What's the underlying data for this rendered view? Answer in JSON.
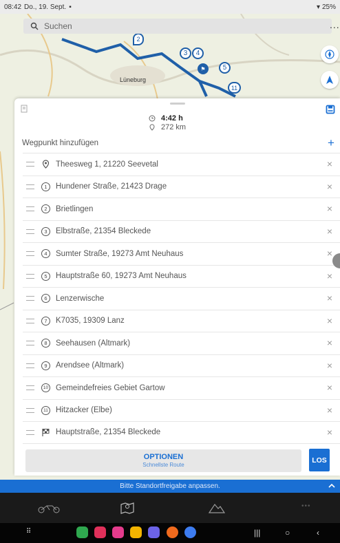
{
  "status": {
    "time": "08:42",
    "date": "Do., 19. Sept.",
    "battery": "25%"
  },
  "search": {
    "placeholder": "Suchen"
  },
  "menu_dots": "...",
  "map": {
    "town_label": "Lüneburg",
    "markers": [
      "2",
      "3",
      "4",
      "5",
      "11"
    ]
  },
  "route_summary": {
    "duration": "4:42 h",
    "distance": "272 km"
  },
  "add_waypoint_label": "Wegpunkt hinzufügen",
  "waypoints": [
    {
      "badge": "",
      "kind": "start",
      "label": "Theesweg 1, 21220 Seevetal"
    },
    {
      "badge": "1",
      "kind": "num",
      "label": "Hundener Straße, 21423 Drage"
    },
    {
      "badge": "2",
      "kind": "num",
      "label": "Brietlingen"
    },
    {
      "badge": "3",
      "kind": "num",
      "label": "Elbstraße, 21354 Bleckede"
    },
    {
      "badge": "4",
      "kind": "num",
      "label": "Sumter Straße, 19273 Amt Neuhaus"
    },
    {
      "badge": "5",
      "kind": "num",
      "label": "Hauptstraße 60, 19273 Amt Neuhaus"
    },
    {
      "badge": "6",
      "kind": "num",
      "label": "Lenzerwische"
    },
    {
      "badge": "7",
      "kind": "num",
      "label": "K7035, 19309 Lanz"
    },
    {
      "badge": "8",
      "kind": "num",
      "label": "Seehausen (Altmark)"
    },
    {
      "badge": "9",
      "kind": "num",
      "label": "Arendsee (Altmark)"
    },
    {
      "badge": "10",
      "kind": "num",
      "label": "Gemeindefreies Gebiet Gartow"
    },
    {
      "badge": "11",
      "kind": "num",
      "label": "Hitzacker (Elbe)"
    },
    {
      "badge": "",
      "kind": "finish",
      "label": "Hauptstraße, 21354 Bleckede"
    }
  ],
  "remove_glyph": "×",
  "options": {
    "title": "OPTIONEN",
    "subtitle": "Schnellste Route"
  },
  "go_button": "LOS",
  "info_banner": "Bitte Standortfreigabe anpassen.",
  "colors": {
    "accent": "#1a6fd3",
    "route": "#1f5fa8"
  },
  "icons": [
    "search-icon",
    "compass-icon",
    "navigation-arrow-icon",
    "save-icon",
    "add-icon",
    "drag-handle-icon",
    "location-pin-icon",
    "finish-flag-icon",
    "close-icon",
    "clock-icon",
    "chevron-up-icon",
    "motorbike-icon",
    "map-icon",
    "mountain-icon"
  ]
}
